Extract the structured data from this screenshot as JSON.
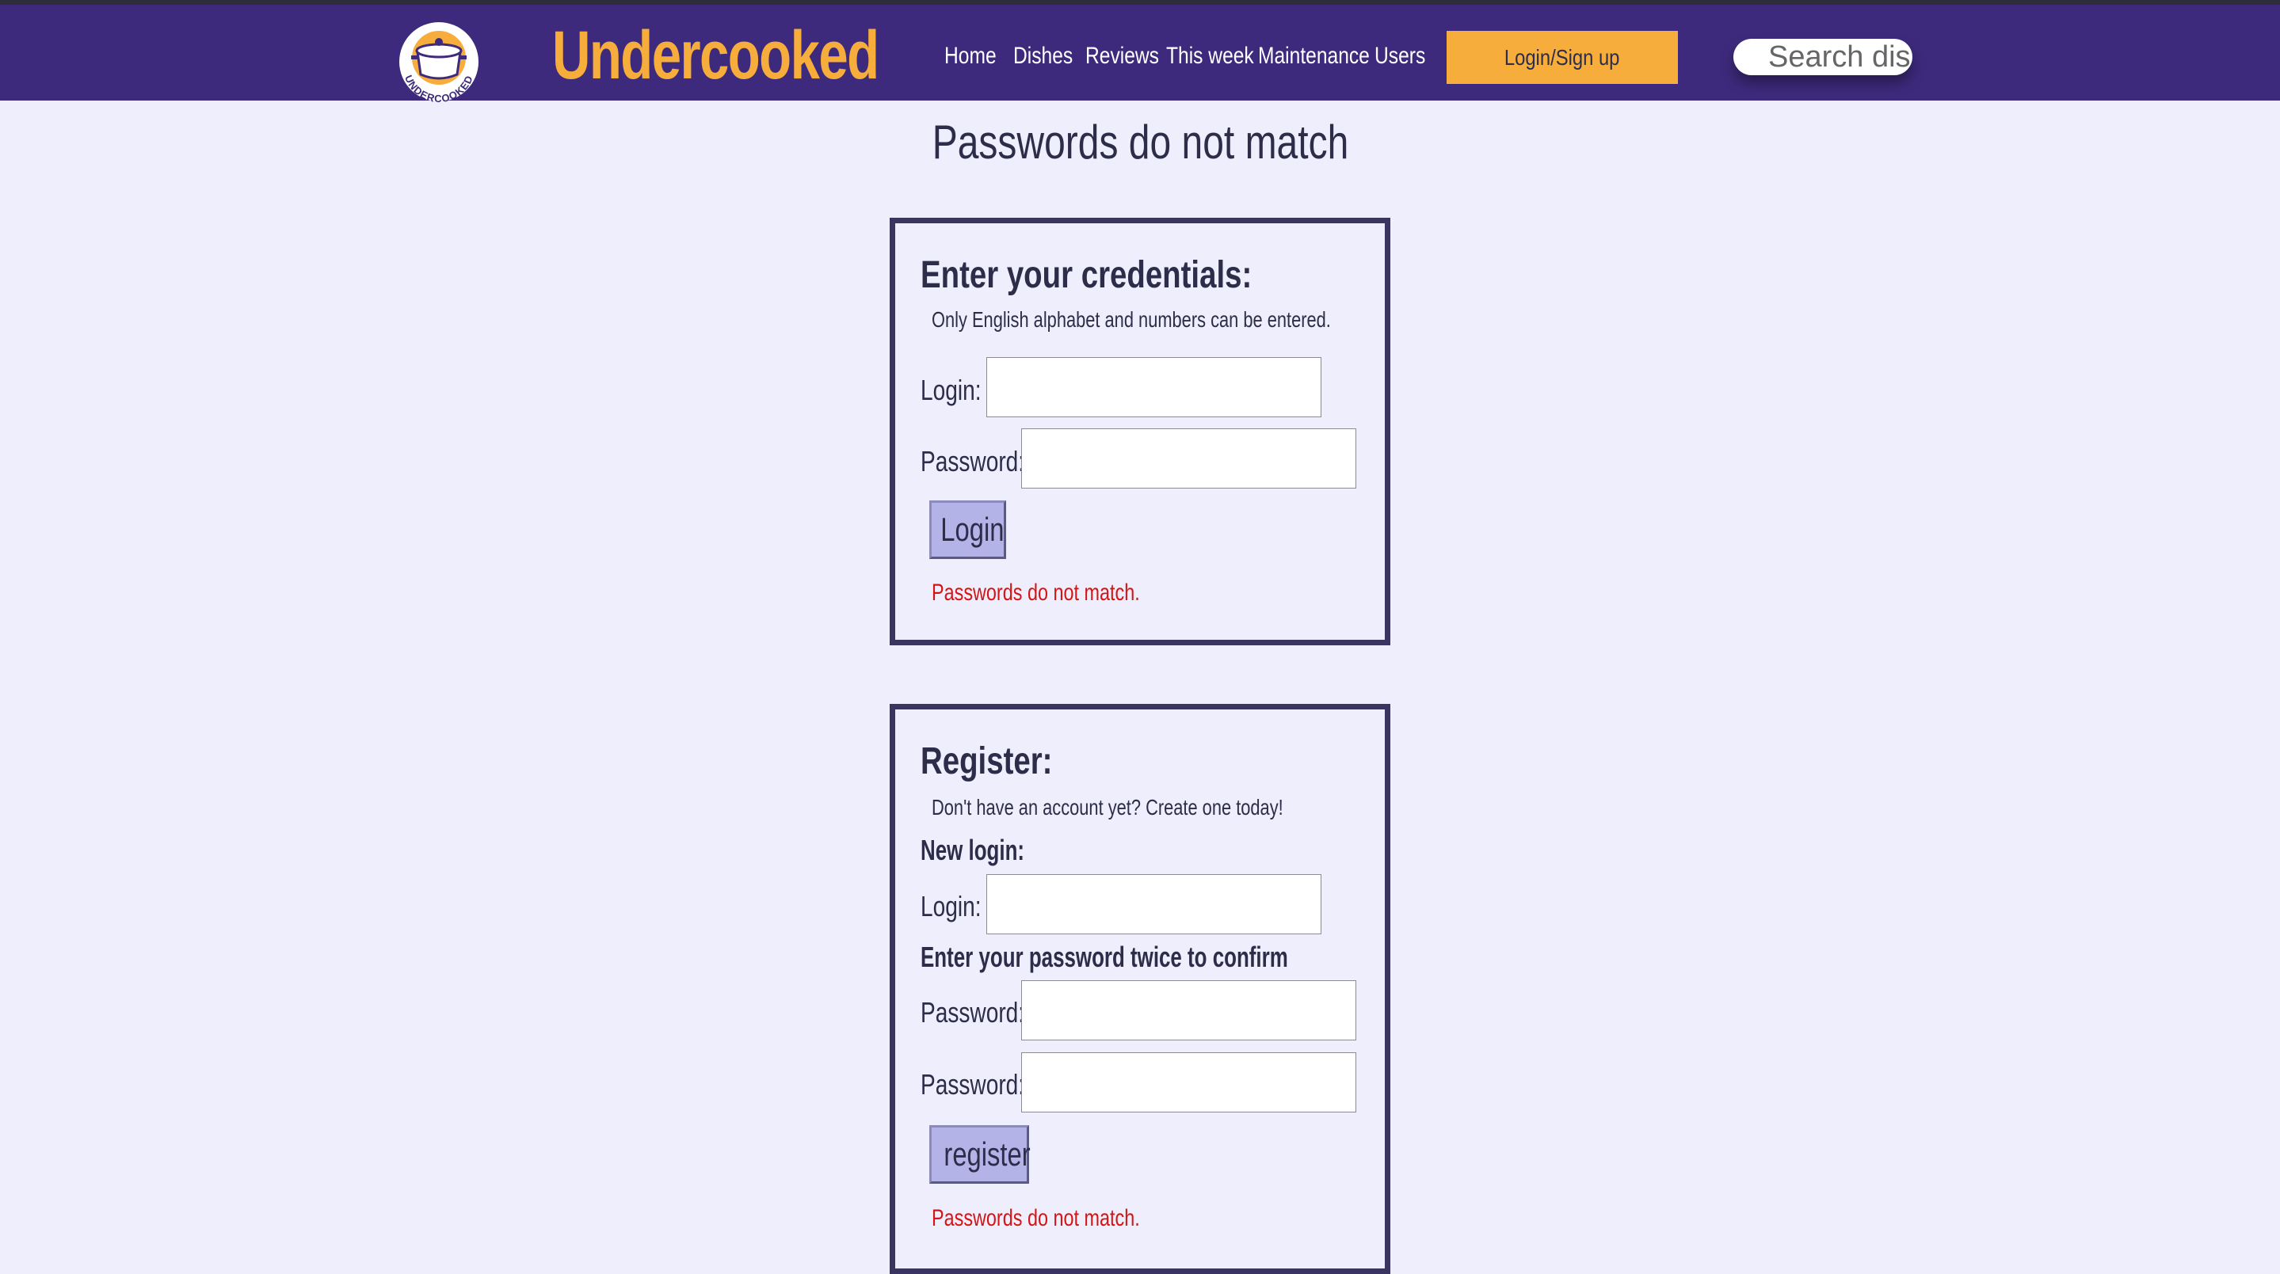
{
  "header": {
    "brand": "Undercooked",
    "logo_text": "UNDERCOOKED",
    "nav": [
      "Home",
      "Dishes",
      "Reviews",
      "This week",
      "Maintenance",
      "Users"
    ],
    "login_button": "Login/Sign up",
    "search_placeholder": "Search dis"
  },
  "page_title": "Passwords do not match",
  "login_form": {
    "title": "Enter your credentials:",
    "hint": "Only English alphabet and numbers can be entered.",
    "login_label": "Login:",
    "login_value": "",
    "password_label": "Password:",
    "password_value": "",
    "submit_label": "Login",
    "error": "Passwords do not match."
  },
  "register_form": {
    "title": "Register:",
    "hint": "Don't have an account yet? Create one today!",
    "new_login_heading": "New login:",
    "login_label": "Login:",
    "login_value": "",
    "password_heading": "Enter your password twice to confirm",
    "password_label": "Password:",
    "password_value": "",
    "password_confirm_label": "Password:",
    "password_confirm_value": "",
    "submit_label": "register",
    "error": "Passwords do not match."
  },
  "colors": {
    "navbar": "#3d2a7c",
    "brand": "#f7ad3b",
    "page_background": "#eeeefc",
    "error": "#d41515",
    "button": "#b3b3e8"
  },
  "icons": {
    "logo": "cooking-pot-logo"
  }
}
